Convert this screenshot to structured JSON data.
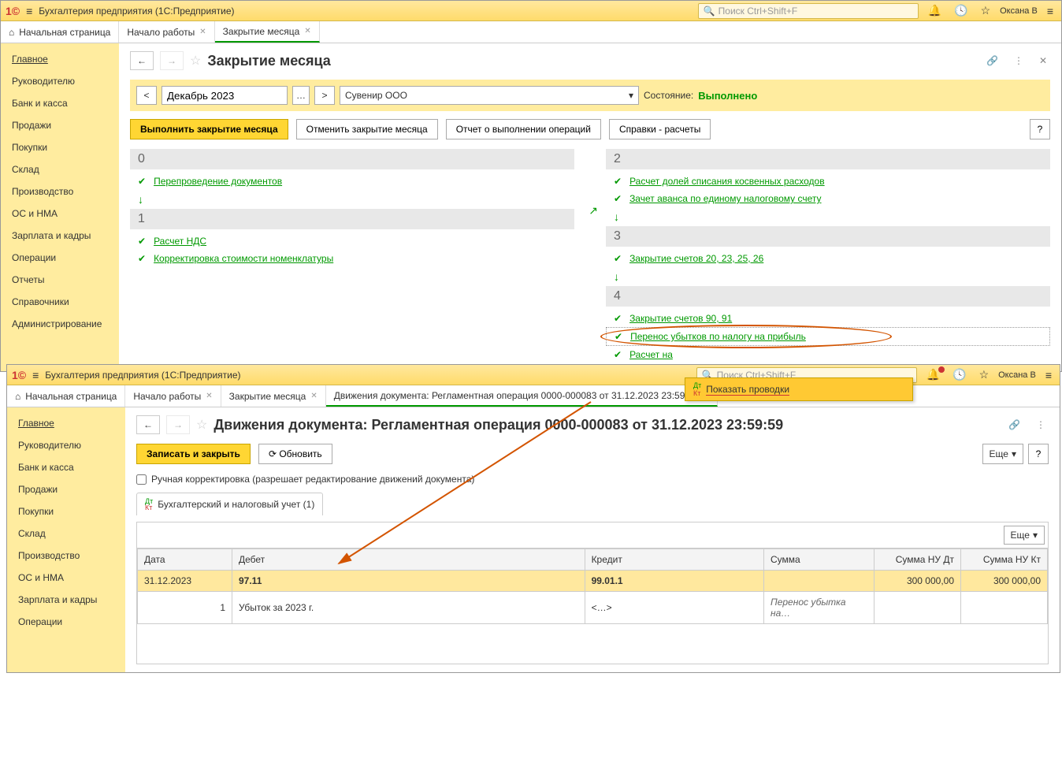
{
  "app": {
    "title": "Бухгалтерия предприятия  (1С:Предприятие)",
    "search_placeholder": "Поиск Ctrl+Shift+F",
    "user": "Оксана В"
  },
  "tabs1": {
    "home": "Начальная страница",
    "t1": "Начало работы",
    "t2": "Закрытие месяца"
  },
  "sidebar": {
    "items": [
      "Главное",
      "Руководителю",
      "Банк и касса",
      "Продажи",
      "Покупки",
      "Склад",
      "Производство",
      "ОС и НМА",
      "Зарплата и кадры",
      "Операции",
      "Отчеты",
      "Справочники",
      "Администрирование"
    ]
  },
  "page1": {
    "title": "Закрытие месяца",
    "period": "Декабрь 2023",
    "org": "Сувенир ООО",
    "state_label": "Состояние:",
    "state_value": "Выполнено",
    "btn_run": "Выполнить закрытие месяца",
    "btn_cancel": "Отменить закрытие месяца",
    "btn_report": "Отчет о выполнении операций",
    "btn_ref": "Справки - расчеты",
    "stage0": "0",
    "s0_1": "Перепроведение документов",
    "stage1": "1",
    "s1_1": "Расчет НДС",
    "s1_2": "Корректировка стоимости номенклатуры",
    "stage2": "2",
    "s2_1": "Расчет долей списания косвенных расходов",
    "s2_2": "Зачет аванса по единому налоговому счету",
    "stage3": "3",
    "s3_1": "Закрытие счетов 20, 23, 25, 26",
    "stage4": "4",
    "s4_1": "Закрытие счетов 90, 91",
    "s4_2": "Перенос убытков по налогу на прибыль",
    "s4_3": "Расчет на",
    "context_menu": "Показать проводки"
  },
  "tabs2": {
    "home": "Начальная страница",
    "t1": "Начало работы",
    "t2": "Закрытие месяца",
    "t3": "Движения документа: Регламентная операция 0000-000083 от 31.12.2023 23:59:59"
  },
  "page2": {
    "title": "Движения документа: Регламентная операция 0000-000083 от 31.12.2023 23:59:59",
    "btn_save": "Записать и закрыть",
    "btn_refresh": "Обновить",
    "btn_more": "Еще",
    "checkbox_label": "Ручная корректировка (разрешает редактирование движений документа)",
    "doctab": "Бухгалтерский и налоговый учет (1)",
    "th_date": "Дата",
    "th_debit": "Дебет",
    "th_credit": "Кредит",
    "th_sum": "Сумма",
    "th_nudt": "Сумма НУ Дт",
    "th_nukt": "Сумма НУ Кт",
    "r1_date": "31.12.2023",
    "r1_debit": "97.11",
    "r1_credit": "99.01.1",
    "r1_nudt": "300 000,00",
    "r1_nukt": "300 000,00",
    "r2_num": "1",
    "r2_debit": "Убыток за 2023 г.",
    "r2_credit": "<…>",
    "r2_sum": "Перенос убытка на…"
  }
}
